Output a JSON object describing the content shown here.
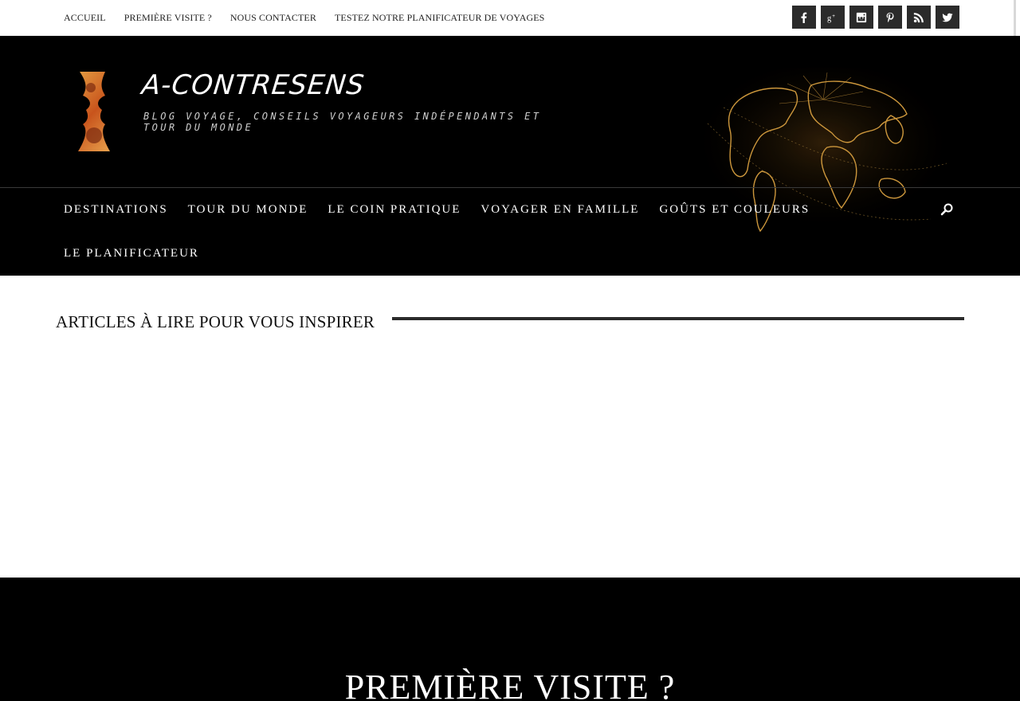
{
  "topnav": {
    "items": [
      "ACCUEIL",
      "PREMIÈRE VISITE ?",
      "NOUS CONTACTER",
      "TESTEZ NOTRE PLANIFICATEUR DE VOYAGES"
    ]
  },
  "socials": [
    {
      "name": "facebook-icon"
    },
    {
      "name": "google-plus-icon"
    },
    {
      "name": "instagram-icon"
    },
    {
      "name": "pinterest-icon"
    },
    {
      "name": "rss-icon"
    },
    {
      "name": "twitter-icon"
    }
  ],
  "header": {
    "title": "A-CONTRESENS",
    "tagline": "BLOG VOYAGE, CONSEILS VOYAGEURS INDÉPENDANTS ET TOUR DU MONDE"
  },
  "mainnav": {
    "items": [
      "DESTINATIONS",
      "TOUR DU MONDE",
      "LE COIN PRATIQUE",
      "VOYAGER EN FAMILLE",
      "GOÛTS ET COULEURS",
      "LE PLANIFICATEUR"
    ]
  },
  "section": {
    "heading": "ARTICLES À LIRE POUR VOUS INSPIRER"
  },
  "band": {
    "heading": "PREMIÈRE VISITE ?"
  },
  "colors": {
    "header_bg": "#000000",
    "social_bg": "#2b2b2b",
    "accent_gold": "#d8a040"
  }
}
